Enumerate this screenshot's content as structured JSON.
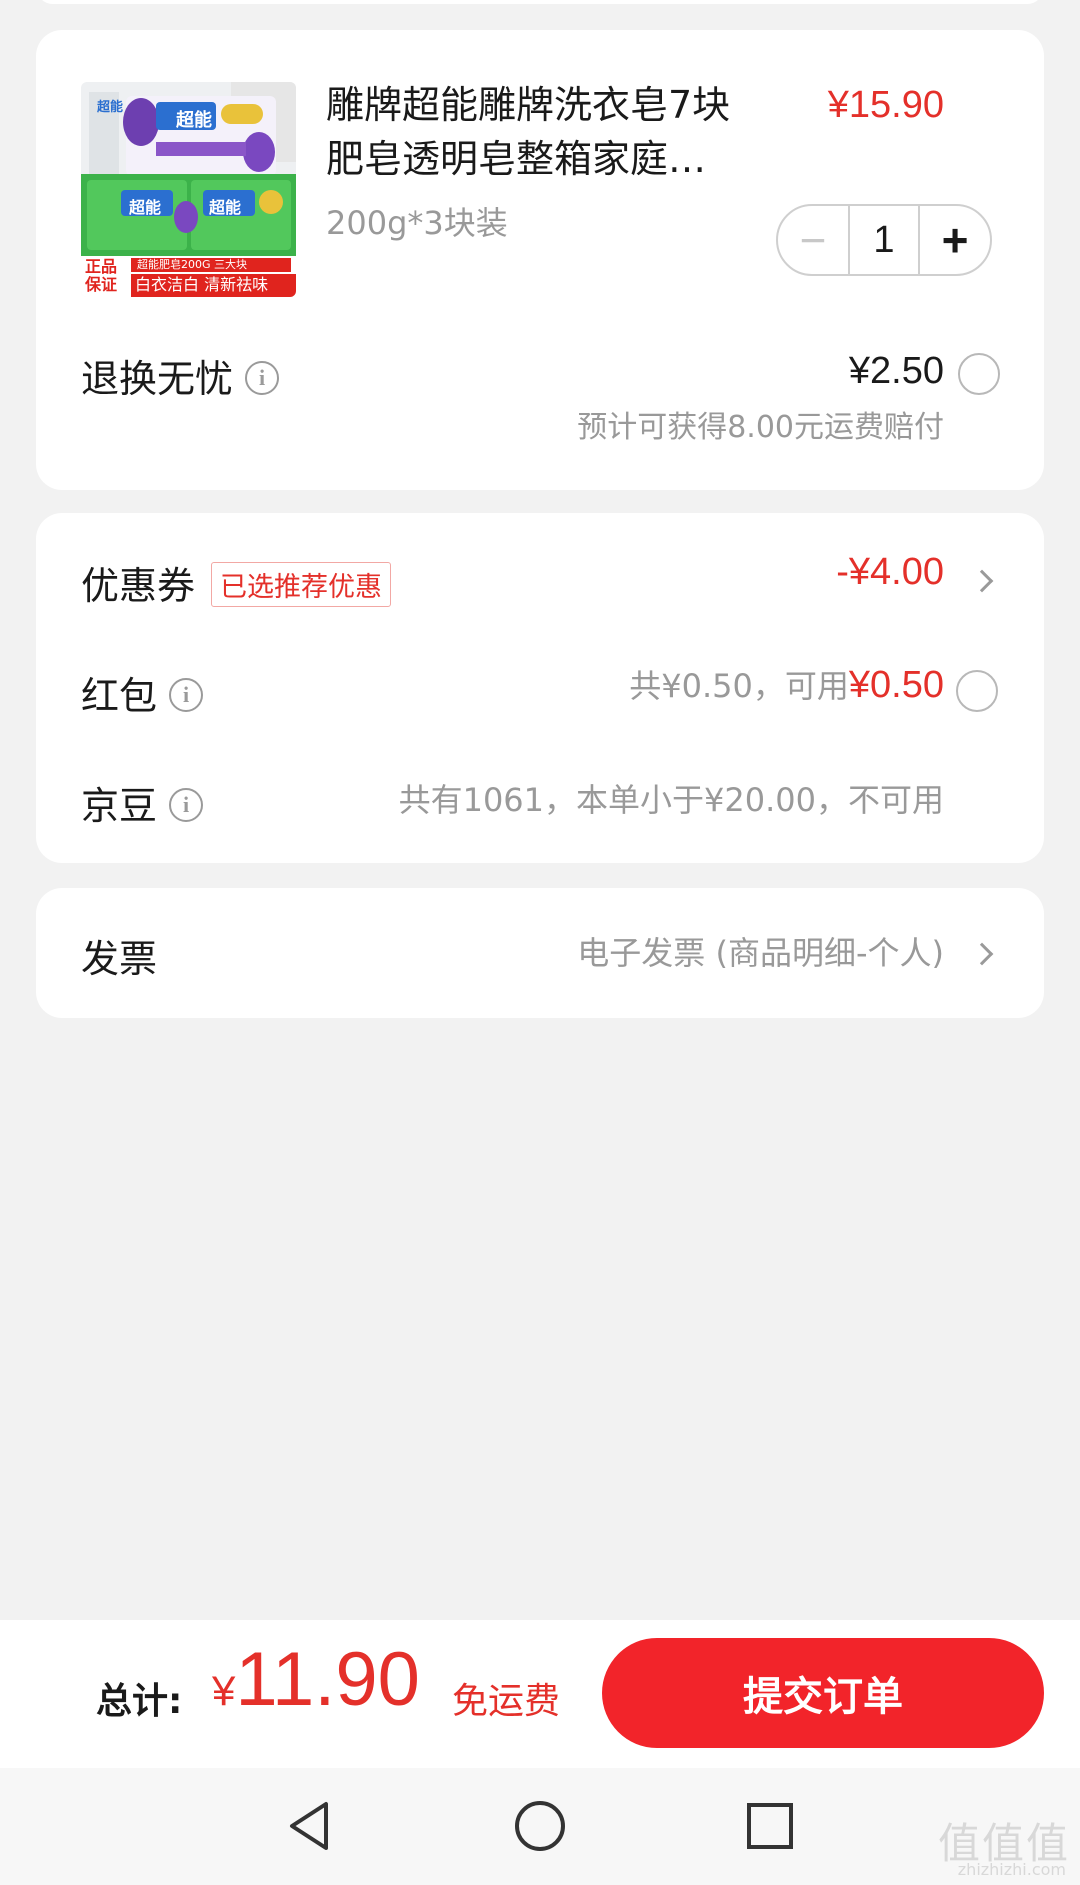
{
  "product": {
    "title_line1": "雕牌超能雕牌洗衣皂7块",
    "title_line2": "肥皂透明皂整箱家庭…",
    "price": "¥15.90",
    "spec": "200g*3块装",
    "quantity": "1",
    "minus_symbol": "−",
    "plus_symbol": "+",
    "image": {
      "brand": "超能",
      "badge_top": "正品",
      "badge_bottom": "保证",
      "banner_top": "超能肥皂200G 三大块",
      "banner_bottom": "白衣洁白 清新祛味"
    }
  },
  "return_service": {
    "label": "退换无忧",
    "price": "¥2.50",
    "note": "预计可获得8.00元运费赔付"
  },
  "coupon": {
    "label": "优惠券",
    "tag": "已选推荐优惠",
    "amount": "-¥4.00"
  },
  "red_packet": {
    "label": "红包",
    "total_text": "共¥0.50，可用",
    "available": "¥0.50"
  },
  "jingdou": {
    "label": "京豆",
    "text": "共有1061，本单小于¥20.00，不可用"
  },
  "invoice": {
    "label": "发票",
    "value": "电子发票 (商品明细-个人)"
  },
  "footer": {
    "total_label": "总计:",
    "currency": "¥",
    "total_amount": "11.90",
    "shipping": "免运费",
    "submit_label": "提交订单"
  },
  "watermark": {
    "main": "值值值",
    "sub": "zhizhizhi.com"
  },
  "icons": {
    "info": "info-icon",
    "chevron": "chevron-right-icon",
    "back": "back-triangle-icon",
    "home": "home-circle-icon",
    "recents": "recents-square-icon"
  },
  "colors": {
    "accent": "#e4302a",
    "button": "#f2242a",
    "background": "#f2f2f2"
  }
}
